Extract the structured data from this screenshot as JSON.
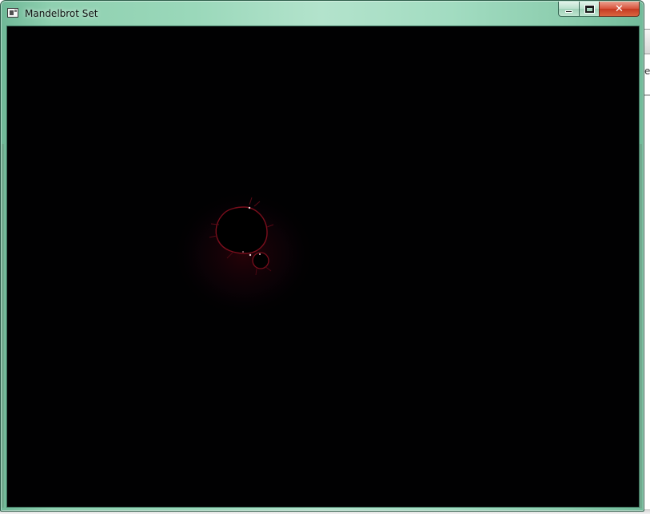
{
  "window": {
    "title": "Mandelbrot Set",
    "caption_buttons": {
      "minimize": "minimize",
      "maximize": "maximize",
      "close": "✕"
    }
  },
  "background": {
    "partial_text": "e"
  },
  "canvas": {
    "background_color": "#010102",
    "fractal_color": "#000000",
    "edge_color": "#b0162a"
  }
}
